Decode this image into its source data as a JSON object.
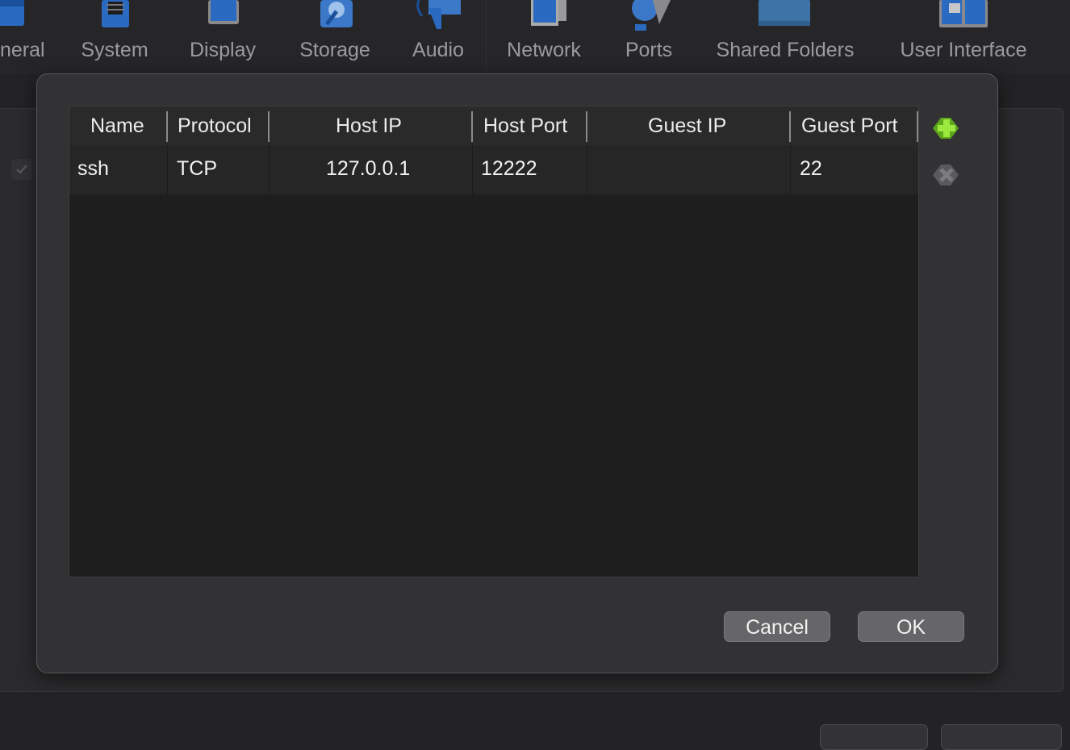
{
  "toolbar": {
    "items": [
      {
        "label": "neral",
        "icon": "general-icon"
      },
      {
        "label": "System",
        "icon": "system-chip-icon"
      },
      {
        "label": "Display",
        "icon": "display-monitor-icon"
      },
      {
        "label": "Storage",
        "icon": "storage-disk-icon"
      },
      {
        "label": "Audio",
        "icon": "audio-speaker-icon"
      },
      {
        "label": "Network",
        "icon": "network-icon"
      },
      {
        "label": "Ports",
        "icon": "ports-plug-icon"
      },
      {
        "label": "Shared Folders",
        "icon": "shared-folder-icon"
      },
      {
        "label": "User Interface",
        "icon": "user-interface-icon"
      }
    ]
  },
  "dialog": {
    "columns": [
      "Name",
      "Protocol",
      "Host IP",
      "Host Port",
      "Guest IP",
      "Guest Port"
    ],
    "rows": [
      {
        "name": "ssh",
        "protocol": "TCP",
        "host_ip": "127.0.0.1",
        "host_port": "12222",
        "guest_ip": "",
        "guest_port": "22"
      }
    ],
    "add_rule_icon": "add-rule-icon",
    "remove_rule_icon": "remove-rule-icon",
    "cancel_label": "Cancel",
    "ok_label": "OK"
  },
  "colors": {
    "add_icon": "#7fd12a",
    "toolbar_icon": "#1f5fb0",
    "dialog_bg": "#323234",
    "table_bg": "#1e1e1e"
  }
}
